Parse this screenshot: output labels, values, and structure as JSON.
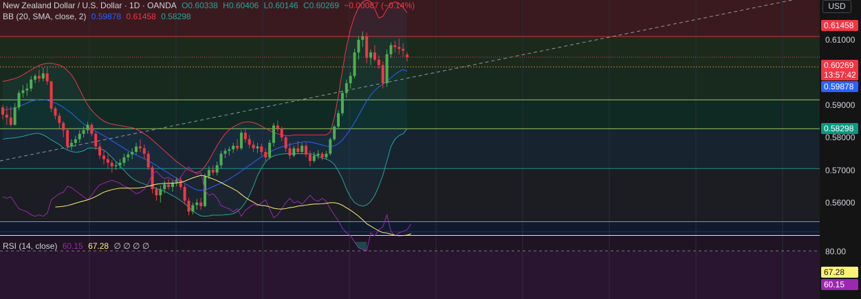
{
  "header": {
    "symbol": "New Zealand Dollar / U.S. Dollar · 1D · OANDA",
    "open": "O0.60338",
    "high": "H0.60406",
    "low": "L0.60146",
    "close": "C0.60269",
    "change": "−0.00087 (−0.14%)"
  },
  "bb_legend": {
    "label": "BB (20, SMA, close, 2)",
    "basis": "0.59878",
    "upper": "0.61458",
    "lower": "0.58298"
  },
  "rsi_legend": {
    "label": "RSI (14, close)",
    "rsi": "60.15",
    "ma": "67.28",
    "extras": "∅ ∅ ∅ ∅"
  },
  "axis": {
    "currency": "USD",
    "ticks": [
      "0.61000",
      "0.59000",
      "0.58000",
      "0.57000",
      "0.56000"
    ],
    "rsi_ticks": [
      "80.00"
    ]
  },
  "tags": {
    "bb_upper": "0.61458",
    "last_price": "0.60269",
    "countdown": "13:57:42",
    "bb_basis": "0.59878",
    "bb_lower": "0.58298",
    "rsi_ma": "67.28",
    "rsi": "60.15"
  },
  "colors": {
    "up": "#26a69a",
    "up_body": "#4caf50",
    "down": "#f23645",
    "basis": "#2962ff",
    "upper": "#f23645",
    "lower": "#26a69a",
    "rsi": "#9c27b0",
    "rsi_ma": "#fff176"
  },
  "chart_data": {
    "type": "candlestick",
    "title": "New Zealand Dollar / U.S. Dollar · 1D · OANDA",
    "ylim": [
      0.5535,
      0.6185
    ],
    "horizontal_levels": [
      0.6084,
      0.6,
      0.5909,
      0.5829,
      0.5719,
      0.5572
    ],
    "candles": [
      [
        0.5888,
        0.5895,
        0.5855,
        0.5868
      ],
      [
        0.5868,
        0.5892,
        0.584,
        0.586
      ],
      [
        0.586,
        0.589,
        0.5835,
        0.584
      ],
      [
        0.584,
        0.59,
        0.5838,
        0.5888
      ],
      [
        0.5888,
        0.5935,
        0.588,
        0.5928
      ],
      [
        0.5928,
        0.595,
        0.5915,
        0.5935
      ],
      [
        0.5935,
        0.5955,
        0.592,
        0.594
      ],
      [
        0.594,
        0.5975,
        0.5932,
        0.5965
      ],
      [
        0.5965,
        0.598,
        0.5955,
        0.5975
      ],
      [
        0.5975,
        0.5992,
        0.5958,
        0.5968
      ],
      [
        0.5968,
        0.5998,
        0.596,
        0.5982
      ],
      [
        0.5982,
        0.5998,
        0.595,
        0.596
      ],
      [
        0.596,
        0.5962,
        0.5875,
        0.5885
      ],
      [
        0.5885,
        0.589,
        0.5855,
        0.5865
      ],
      [
        0.5865,
        0.5872,
        0.583,
        0.5845
      ],
      [
        0.5845,
        0.585,
        0.5805,
        0.5825
      ],
      [
        0.5825,
        0.583,
        0.577,
        0.578
      ],
      [
        0.578,
        0.58,
        0.577,
        0.579
      ],
      [
        0.579,
        0.581,
        0.578,
        0.58
      ],
      [
        0.58,
        0.5825,
        0.579,
        0.5815
      ],
      [
        0.5815,
        0.5835,
        0.5805,
        0.5825
      ],
      [
        0.5825,
        0.5848,
        0.5815,
        0.584
      ],
      [
        0.584,
        0.5845,
        0.5808,
        0.5815
      ],
      [
        0.5815,
        0.582,
        0.577,
        0.578
      ],
      [
        0.578,
        0.579,
        0.5745,
        0.5755
      ],
      [
        0.5755,
        0.577,
        0.573,
        0.5745
      ],
      [
        0.5745,
        0.5758,
        0.572,
        0.5735
      ],
      [
        0.5735,
        0.5742,
        0.5708,
        0.5725
      ],
      [
        0.5725,
        0.5738,
        0.5715,
        0.5728
      ],
      [
        0.5728,
        0.5745,
        0.572,
        0.5735
      ],
      [
        0.5735,
        0.576,
        0.5725,
        0.575
      ],
      [
        0.575,
        0.5765,
        0.574,
        0.5758
      ],
      [
        0.5758,
        0.5775,
        0.5745,
        0.5765
      ],
      [
        0.5765,
        0.579,
        0.5758,
        0.578
      ],
      [
        0.578,
        0.58,
        0.5765,
        0.5775
      ],
      [
        0.5775,
        0.5785,
        0.5745,
        0.576
      ],
      [
        0.576,
        0.5768,
        0.5715,
        0.5722
      ],
      [
        0.5722,
        0.5728,
        0.565,
        0.5662
      ],
      [
        0.5662,
        0.5668,
        0.563,
        0.5645
      ],
      [
        0.5645,
        0.5672,
        0.5625,
        0.5662
      ],
      [
        0.5662,
        0.5685,
        0.565,
        0.5675
      ],
      [
        0.5675,
        0.569,
        0.566,
        0.5668
      ],
      [
        0.5668,
        0.5688,
        0.5655,
        0.568
      ],
      [
        0.568,
        0.5695,
        0.567,
        0.5688
      ],
      [
        0.5688,
        0.5695,
        0.566,
        0.5668
      ],
      [
        0.5668,
        0.5675,
        0.562,
        0.563
      ],
      [
        0.563,
        0.5638,
        0.559,
        0.56
      ],
      [
        0.56,
        0.5625,
        0.5592,
        0.5618
      ],
      [
        0.5618,
        0.5635,
        0.5605,
        0.5625
      ],
      [
        0.5625,
        0.5638,
        0.5605,
        0.5615
      ],
      [
        0.5615,
        0.5705,
        0.5612,
        0.5698
      ],
      [
        0.5698,
        0.5725,
        0.569,
        0.5715
      ],
      [
        0.5715,
        0.5728,
        0.57,
        0.5708
      ],
      [
        0.5708,
        0.5738,
        0.57,
        0.5728
      ],
      [
        0.5728,
        0.5768,
        0.572,
        0.576
      ],
      [
        0.576,
        0.5775,
        0.5748,
        0.5768
      ],
      [
        0.5768,
        0.578,
        0.5755,
        0.5772
      ],
      [
        0.5772,
        0.579,
        0.5762,
        0.5782
      ],
      [
        0.5782,
        0.58,
        0.5768,
        0.5775
      ],
      [
        0.5775,
        0.5825,
        0.577,
        0.5818
      ],
      [
        0.5818,
        0.5832,
        0.579,
        0.58
      ],
      [
        0.58,
        0.5812,
        0.5775,
        0.5785
      ],
      [
        0.5785,
        0.5795,
        0.5765,
        0.5775
      ],
      [
        0.5775,
        0.579,
        0.5762,
        0.578
      ],
      [
        0.578,
        0.5788,
        0.5755,
        0.5765
      ],
      [
        0.5765,
        0.5775,
        0.574,
        0.575
      ],
      [
        0.575,
        0.5798,
        0.5745,
        0.579
      ],
      [
        0.579,
        0.5845,
        0.578,
        0.5838
      ],
      [
        0.5838,
        0.5852,
        0.582,
        0.583
      ],
      [
        0.583,
        0.5835,
        0.5795,
        0.5805
      ],
      [
        0.5805,
        0.581,
        0.5765,
        0.5775
      ],
      [
        0.5775,
        0.579,
        0.5745,
        0.5755
      ],
      [
        0.5755,
        0.5782,
        0.575,
        0.5775
      ],
      [
        0.5775,
        0.5795,
        0.576,
        0.5765
      ],
      [
        0.5765,
        0.579,
        0.5758,
        0.5782
      ],
      [
        0.5782,
        0.579,
        0.575,
        0.5758
      ],
      [
        0.5758,
        0.5768,
        0.5725,
        0.574
      ],
      [
        0.574,
        0.5765,
        0.5735,
        0.5755
      ],
      [
        0.5755,
        0.577,
        0.5745,
        0.576
      ],
      [
        0.576,
        0.5765,
        0.5742,
        0.575
      ],
      [
        0.575,
        0.5768,
        0.5745,
        0.576
      ],
      [
        0.576,
        0.5805,
        0.5755,
        0.58
      ],
      [
        0.58,
        0.584,
        0.5795,
        0.5835
      ],
      [
        0.5835,
        0.588,
        0.5828,
        0.5872
      ],
      [
        0.5872,
        0.5935,
        0.5865,
        0.5928
      ],
      [
        0.5928,
        0.5965,
        0.5915,
        0.5955
      ],
      [
        0.5955,
        0.5985,
        0.594,
        0.5975
      ],
      [
        0.5975,
        0.605,
        0.5968,
        0.604
      ],
      [
        0.604,
        0.6085,
        0.602,
        0.6075
      ],
      [
        0.6075,
        0.6098,
        0.6055,
        0.6085
      ],
      [
        0.6085,
        0.6095,
        0.601,
        0.6025
      ],
      [
        0.6025,
        0.6048,
        0.6005,
        0.604
      ],
      [
        0.604,
        0.606,
        0.6015,
        0.602
      ],
      [
        0.602,
        0.6032,
        0.5995,
        0.6005
      ],
      [
        0.6005,
        0.6015,
        0.594,
        0.5955
      ],
      [
        0.5955,
        0.6048,
        0.5945,
        0.6035
      ],
      [
        0.6035,
        0.6068,
        0.6025,
        0.606
      ],
      [
        0.606,
        0.6072,
        0.604,
        0.6055
      ],
      [
        0.6055,
        0.6078,
        0.6035,
        0.605
      ],
      [
        0.605,
        0.6065,
        0.6028,
        0.6045
      ],
      [
        0.6034,
        0.6041,
        0.6015,
        0.6027
      ]
    ],
    "bb_upper": [
      0.596,
      0.5962,
      0.5965,
      0.5968,
      0.5972,
      0.5978,
      0.5985,
      0.5992,
      0.5998,
      0.6004,
      0.6008,
      0.601,
      0.601,
      0.6008,
      0.6005,
      0.6,
      0.599,
      0.5978,
      0.596,
      0.5938,
      0.5915,
      0.5895,
      0.588,
      0.5868,
      0.5858,
      0.585,
      0.5845,
      0.5842,
      0.584,
      0.5838,
      0.5836,
      0.5834,
      0.5832,
      0.5828,
      0.5822,
      0.5815,
      0.5808,
      0.5798,
      0.5788,
      0.5778,
      0.5768,
      0.5758,
      0.5748,
      0.5738,
      0.573,
      0.5722,
      0.5715,
      0.571,
      0.5708,
      0.5712,
      0.5725,
      0.5742,
      0.5762,
      0.5782,
      0.58,
      0.5815,
      0.5826,
      0.5834,
      0.584,
      0.5845,
      0.5848,
      0.5848,
      0.5846,
      0.5842,
      0.5836,
      0.583,
      0.5824,
      0.5819,
      0.5815,
      0.5812,
      0.581,
      0.581,
      0.5812,
      0.5812,
      0.5812,
      0.5812,
      0.5812,
      0.5812,
      0.5812,
      0.5812,
      0.5812,
      0.582,
      0.586,
      0.592,
      0.599,
      0.6055,
      0.6105,
      0.614,
      0.6165,
      0.618,
      0.6185,
      0.618,
      0.616,
      0.6135,
      0.614,
      0.616,
      0.6175,
      0.618,
      0.6176,
      0.6165,
      0.615
    ],
    "bb_basis": [
      0.588,
      0.5882,
      0.5884,
      0.5886,
      0.589,
      0.5895,
      0.59,
      0.5905,
      0.5908,
      0.591,
      0.591,
      0.5908,
      0.5904,
      0.59,
      0.5895,
      0.5888,
      0.588,
      0.5872,
      0.5862,
      0.5852,
      0.5842,
      0.5835,
      0.5828,
      0.5822,
      0.5816,
      0.581,
      0.5803,
      0.5796,
      0.5789,
      0.5782,
      0.5775,
      0.5768,
      0.5762,
      0.5756,
      0.5751,
      0.5746,
      0.574,
      0.5734,
      0.5727,
      0.572,
      0.5713,
      0.5706,
      0.5699,
      0.5692,
      0.5685,
      0.5678,
      0.5671,
      0.5665,
      0.566,
      0.5658,
      0.566,
      0.5664,
      0.5669,
      0.5674,
      0.5679,
      0.5684,
      0.569,
      0.5697,
      0.5704,
      0.5712,
      0.572,
      0.5728,
      0.5736,
      0.5744,
      0.5751,
      0.5758,
      0.5764,
      0.577,
      0.5775,
      0.5779,
      0.5782,
      0.5785,
      0.5788,
      0.579,
      0.5792,
      0.5793,
      0.5792,
      0.579,
      0.5787,
      0.5784,
      0.5781,
      0.578,
      0.5782,
      0.5788,
      0.5798,
      0.5812,
      0.5828,
      0.5846,
      0.5866,
      0.5886,
      0.5906,
      0.5922,
      0.5935,
      0.5945,
      0.5952,
      0.596,
      0.597,
      0.5979,
      0.5987,
      0.5993,
      0.5988
    ],
    "bb_lower": [
      0.58,
      0.5802,
      0.5803,
      0.5804,
      0.5806,
      0.5808,
      0.5811,
      0.5814,
      0.5816,
      0.5816,
      0.5812,
      0.5806,
      0.5798,
      0.5792,
      0.5785,
      0.5776,
      0.577,
      0.5766,
      0.5764,
      0.5765,
      0.5768,
      0.5775,
      0.5776,
      0.5775,
      0.5773,
      0.577,
      0.5761,
      0.575,
      0.5738,
      0.5726,
      0.5714,
      0.5702,
      0.5692,
      0.5685,
      0.568,
      0.5676,
      0.5672,
      0.5668,
      0.5664,
      0.566,
      0.5656,
      0.565,
      0.5644,
      0.5638,
      0.563,
      0.5622,
      0.5612,
      0.5602,
      0.5594,
      0.5588,
      0.5587,
      0.5588,
      0.559,
      0.559,
      0.559,
      0.5591,
      0.5592,
      0.5594,
      0.56,
      0.561,
      0.5625,
      0.5645,
      0.567,
      0.57,
      0.572,
      0.5738,
      0.5748,
      0.5754,
      0.5757,
      0.5759,
      0.576,
      0.576,
      0.576,
      0.576,
      0.576,
      0.576,
      0.576,
      0.5758,
      0.5752,
      0.5748,
      0.5745,
      0.574,
      0.573,
      0.5712,
      0.569,
      0.5662,
      0.564,
      0.5625,
      0.5618,
      0.5615,
      0.5618,
      0.5628,
      0.5645,
      0.567,
      0.57,
      0.574,
      0.578,
      0.58,
      0.581,
      0.5815,
      0.5829
    ],
    "rsi": [
      44,
      45,
      44,
      48,
      52,
      53,
      54,
      56,
      57,
      56,
      57,
      55,
      46,
      44,
      42,
      41,
      37,
      38,
      40,
      42,
      44,
      46,
      43,
      39,
      36,
      35,
      34,
      33,
      34,
      35,
      37,
      38,
      40,
      42,
      41,
      39,
      35,
      29,
      27,
      30,
      32,
      31,
      33,
      34,
      31,
      27,
      24,
      27,
      29,
      28,
      40,
      43,
      42,
      45,
      50,
      51,
      52,
      54,
      52,
      57,
      53,
      51,
      49,
      50,
      48,
      46,
      52,
      58,
      56,
      52,
      48,
      45,
      48,
      47,
      49,
      46,
      43,
      46,
      47,
      45,
      47,
      52,
      56,
      60,
      65,
      68,
      70,
      74,
      78,
      79,
      80,
      68,
      70,
      66,
      64,
      56,
      67,
      70,
      68,
      67,
      66,
      62
    ],
    "rsi_ma": [
      null,
      null,
      null,
      null,
      null,
      null,
      null,
      null,
      null,
      null,
      null,
      null,
      null,
      null,
      null,
      null,
      null,
      null,
      null,
      null,
      null,
      null,
      null,
      null,
      null,
      null,
      null,
      null,
      null,
      null,
      null,
      null,
      null,
      null,
      null,
      null,
      null,
      null,
      null,
      null,
      null,
      null,
      null,
      null,
      null,
      null,
      null,
      null,
      null,
      null,
      null,
      null,
      null,
      null,
      null,
      null,
      null,
      null,
      null,
      null,
      null,
      null,
      null,
      null,
      null,
      null,
      null,
      null,
      null,
      null,
      null,
      null,
      null,
      null,
      null,
      null,
      null,
      null,
      null,
      null,
      null,
      null,
      null,
      null,
      null,
      null,
      null,
      null,
      null,
      null,
      null,
      null,
      null,
      null,
      null,
      null,
      null,
      null,
      null,
      null,
      null,
      67.28
    ]
  }
}
